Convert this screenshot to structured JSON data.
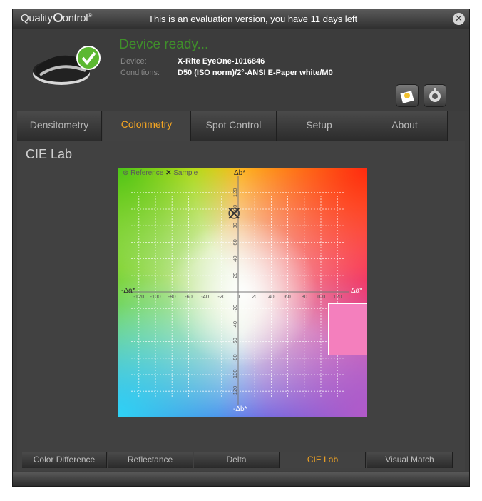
{
  "app": {
    "logo_text": "QualityControl",
    "evaluation_notice": "This is an evaluation version, you have 11 days left"
  },
  "header": {
    "status": "Device ready...",
    "device_label": "Device:",
    "device_value": "X-Rite EyeOne-1016846",
    "conditions_label": "Conditions:",
    "conditions_value": "D50 (ISO norm)/2°-ANSI E-Paper white/M0"
  },
  "tabs": [
    {
      "label": "Densitometry"
    },
    {
      "label": "Colorimetry"
    },
    {
      "label": "Spot Control"
    },
    {
      "label": "Setup"
    },
    {
      "label": "About"
    }
  ],
  "active_tab": "Colorimetry",
  "section": {
    "title": "CIE Lab"
  },
  "plot": {
    "legend": {
      "reference": "Reference",
      "sample": "Sample"
    },
    "axis_pos_b": "Δb*",
    "axis_neg_b": "-Δb*",
    "axis_neg_a": "-Δa*",
    "axis_pos_a": "Δa*",
    "x_ticks": [
      "-120",
      "-100",
      "-80",
      "-60",
      "-40",
      "-20",
      "0",
      "20",
      "40",
      "60",
      "80",
      "100",
      "120"
    ],
    "y_ticks": [
      "120",
      "100",
      "80",
      "60",
      "40",
      "20",
      "0",
      "-20",
      "-40",
      "-60",
      "-80",
      "-100",
      "-120"
    ],
    "reference_point": {
      "a": -5,
      "b": 95
    },
    "sample_point": {
      "a": -5,
      "b": 95
    },
    "sample_swatch_color": "#f47fbd"
  },
  "bottom_tabs": [
    {
      "label": "Color Difference"
    },
    {
      "label": "Reflectance"
    },
    {
      "label": "Delta"
    },
    {
      "label": "CIE Lab"
    },
    {
      "label": "Visual Match"
    }
  ],
  "active_bottom_tab": "CIE Lab",
  "colors": {
    "accent": "#f5a623",
    "status_green": "#3f8f2a"
  }
}
